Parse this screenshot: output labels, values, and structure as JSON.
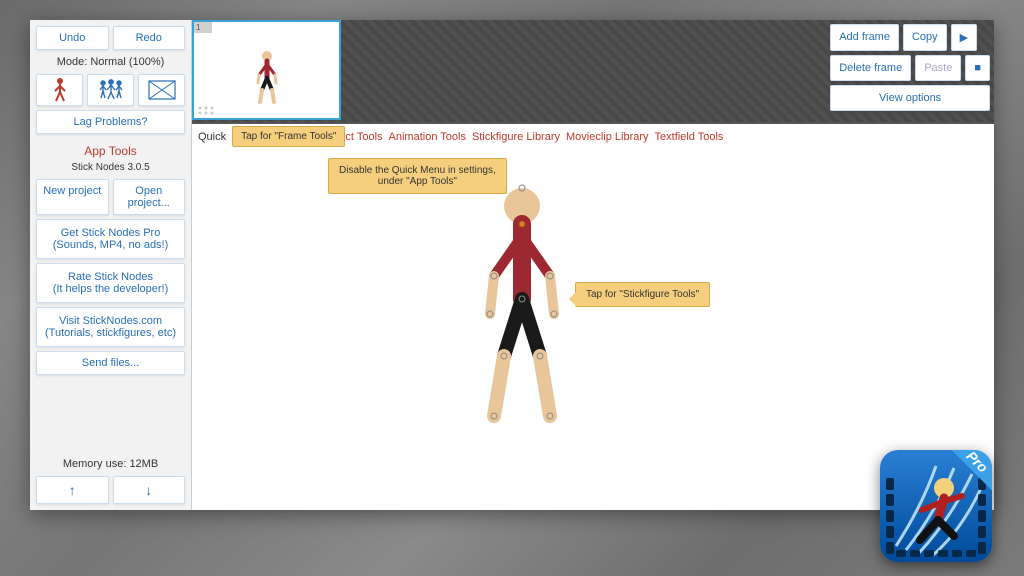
{
  "sidebar": {
    "undo": "Undo",
    "redo": "Redo",
    "mode": "Mode: Normal (100%)",
    "lag": "Lag Problems?",
    "section_title": "App Tools",
    "version": "Stick Nodes 3.0.5",
    "new_project": "New project",
    "open_project": "Open project...",
    "get_pro": "Get Stick Nodes Pro\n(Sounds, MP4, no ads!)",
    "rate": "Rate Stick Nodes\n(It helps the developer!)",
    "visit": "Visit StickNodes.com\n(Tutorials, stickfigures, etc)",
    "send_files": "Send files...",
    "memory": "Memory use: 12MB"
  },
  "timeline": {
    "frame_number": "1"
  },
  "frame_controls": {
    "add": "Add frame",
    "copy": "Copy",
    "delete": "Delete frame",
    "paste": "Paste",
    "view": "View options"
  },
  "quickmenu": {
    "label": "Quick Menu:",
    "frame_tools_tip": "Tap for \"Frame Tools\"",
    "project_tools": "Project Tools",
    "project_tools_clipped": "ct Tools",
    "animation_tools": "Animation Tools",
    "stickfigure_library": "Stickfigure Library",
    "movieclip_library": "Movieclip Library",
    "textfield_tools": "Textfield Tools"
  },
  "tips": {
    "disable_quick": "Disable the Quick Menu in settings,\nunder \"App Tools\"",
    "stickfigure_tools": "Tap for \"Stickfigure Tools\""
  },
  "app_icon": {
    "badge": "Pro"
  },
  "colors": {
    "accent": "#2a6fb8",
    "danger": "#c0392b",
    "skin": "#e9c59a",
    "shirt": "#9c2832",
    "pants": "#1a1a1a",
    "tip_bg": "#f5cf7d"
  }
}
